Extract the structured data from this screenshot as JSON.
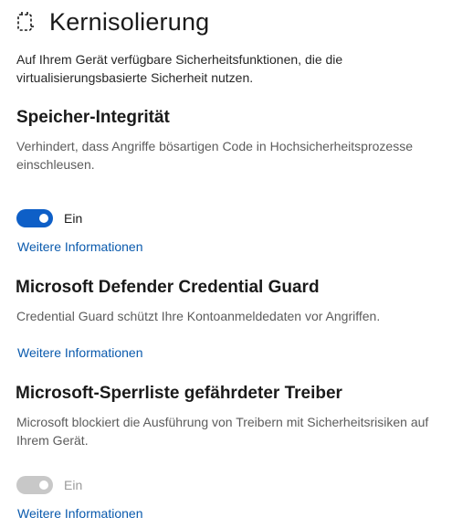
{
  "header": {
    "title": "Kernisolierung",
    "icon": "core-isolation-chip-icon"
  },
  "intro": "Auf Ihrem Gerät verfügbare Sicherheitsfunktionen, die die virtualisierungsbasierte Sicherheit nutzen.",
  "sections": [
    {
      "title": "Speicher-Integrität",
      "description": "Verhindert, dass Angriffe bösartigen Code in Hochsicherheitsprozesse einschleusen.",
      "toggle": {
        "state": "on",
        "label": "Ein",
        "accent": "#0e5fc7"
      },
      "link": "Weitere Informationen"
    },
    {
      "title": "Microsoft Defender Credential Guard",
      "description": "Credential Guard schützt Ihre Kontoanmeldedaten vor Angriffen.",
      "link": "Weitere Informationen"
    },
    {
      "title": "Microsoft-Sperrliste gefährdeter Treiber",
      "description": "Microsoft blockiert die Ausführung von Treibern mit Sicherheitsrisiken auf Ihrem Gerät.",
      "toggle": {
        "state": "on-disabled",
        "label": "Ein",
        "accent": "#c8c8c8"
      },
      "link": "Weitere Informationen"
    }
  ],
  "colors": {
    "link": "#0a5aad",
    "toggle_on": "#0e5fc7",
    "toggle_disabled": "#c8c8c8"
  }
}
